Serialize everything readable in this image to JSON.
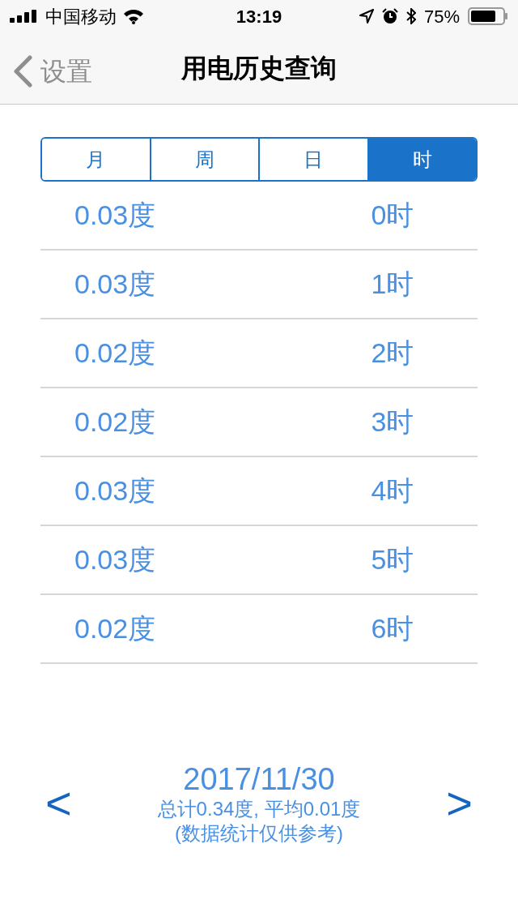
{
  "status_bar": {
    "carrier": "中国移动",
    "time": "13:19",
    "battery": "75%"
  },
  "nav_bar": {
    "back_label": "设置",
    "title": "用电历史查询"
  },
  "tabs": [
    {
      "label": "月",
      "selected": false
    },
    {
      "label": "周",
      "selected": false
    },
    {
      "label": "日",
      "selected": false
    },
    {
      "label": "时",
      "selected": true
    }
  ],
  "rows": [
    {
      "usage": "0.03度",
      "hour": "0时"
    },
    {
      "usage": "0.03度",
      "hour": "1时"
    },
    {
      "usage": "0.02度",
      "hour": "2时"
    },
    {
      "usage": "0.02度",
      "hour": "3时"
    },
    {
      "usage": "0.03度",
      "hour": "4时"
    },
    {
      "usage": "0.03度",
      "hour": "5时"
    },
    {
      "usage": "0.02度",
      "hour": "6时"
    }
  ],
  "footer": {
    "prev": "<",
    "date": "2017/11/30",
    "summary": "总计0.34度, 平均0.01度",
    "note": "(数据统计仅供参考)",
    "next": ">"
  }
}
